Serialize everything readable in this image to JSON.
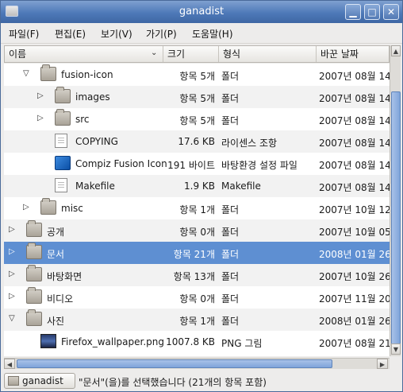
{
  "window": {
    "title": "ganadist"
  },
  "menu": [
    "파일(F)",
    "편집(E)",
    "보기(V)",
    "가기(P)",
    "도움말(H)"
  ],
  "columns": {
    "name": "이름",
    "size": "크기",
    "type": "형식",
    "date": "바꾼 날짜"
  },
  "rows": [
    {
      "indent": 1,
      "expander": "▽",
      "icon": "folder",
      "name": "fusion-icon",
      "size": "항목 5개",
      "type": "폴더",
      "date": "2007년 08월 14",
      "alt": false,
      "selected": false
    },
    {
      "indent": 2,
      "expander": "▷",
      "icon": "folder",
      "name": "images",
      "size": "항목 5개",
      "type": "폴더",
      "date": "2007년 08월 14",
      "alt": true,
      "selected": false
    },
    {
      "indent": 2,
      "expander": "▷",
      "icon": "folder",
      "name": "src",
      "size": "항목 5개",
      "type": "폴더",
      "date": "2007년 08월 14",
      "alt": false,
      "selected": false
    },
    {
      "indent": 2,
      "expander": "",
      "icon": "document",
      "name": "COPYING",
      "size": "17.6 KB",
      "type": "라이센스 조항",
      "date": "2007년 08월 14",
      "alt": true,
      "selected": false
    },
    {
      "indent": 2,
      "expander": "",
      "icon": "compiz",
      "name": "Compiz Fusion Icon",
      "size": "191 바이트",
      "type": "바탕환경 설정 파일",
      "date": "2007년 08월 14",
      "alt": false,
      "selected": false
    },
    {
      "indent": 2,
      "expander": "",
      "icon": "document",
      "name": "Makefile",
      "size": "1.9 KB",
      "type": "Makefile",
      "date": "2007년 08월 14",
      "alt": true,
      "selected": false
    },
    {
      "indent": 1,
      "expander": "▷",
      "icon": "folder",
      "name": "misc",
      "size": "항목 1개",
      "type": "폴더",
      "date": "2007년 10월 12",
      "alt": false,
      "selected": false
    },
    {
      "indent": 0,
      "expander": "▷",
      "icon": "folder",
      "name": "공개",
      "size": "항목 0개",
      "type": "폴더",
      "date": "2007년 10월 05",
      "alt": true,
      "selected": false
    },
    {
      "indent": 0,
      "expander": "▷",
      "icon": "folder",
      "name": "문서",
      "size": "항목 21개",
      "type": "폴더",
      "date": "2008년 01월 26",
      "alt": false,
      "selected": true
    },
    {
      "indent": 0,
      "expander": "▷",
      "icon": "folder",
      "name": "바탕화면",
      "size": "항목 13개",
      "type": "폴더",
      "date": "2007년 10월 26",
      "alt": true,
      "selected": false
    },
    {
      "indent": 0,
      "expander": "▷",
      "icon": "folder",
      "name": "비디오",
      "size": "항목 0개",
      "type": "폴더",
      "date": "2007년 11월 20",
      "alt": false,
      "selected": false
    },
    {
      "indent": 0,
      "expander": "▽",
      "icon": "folder",
      "name": "사진",
      "size": "항목 1개",
      "type": "폴더",
      "date": "2008년 01월 26",
      "alt": true,
      "selected": false
    },
    {
      "indent": 1,
      "expander": "",
      "icon": "image",
      "name": "Firefox_wallpaper.png",
      "size": "1007.8 KB",
      "type": "PNG 그림",
      "date": "2007년 08월 21",
      "alt": false,
      "selected": false
    }
  ],
  "status": {
    "location": "ganadist",
    "message": "\"문서\"(을)를 선택했습니다 (21개의 항목 포함)"
  }
}
